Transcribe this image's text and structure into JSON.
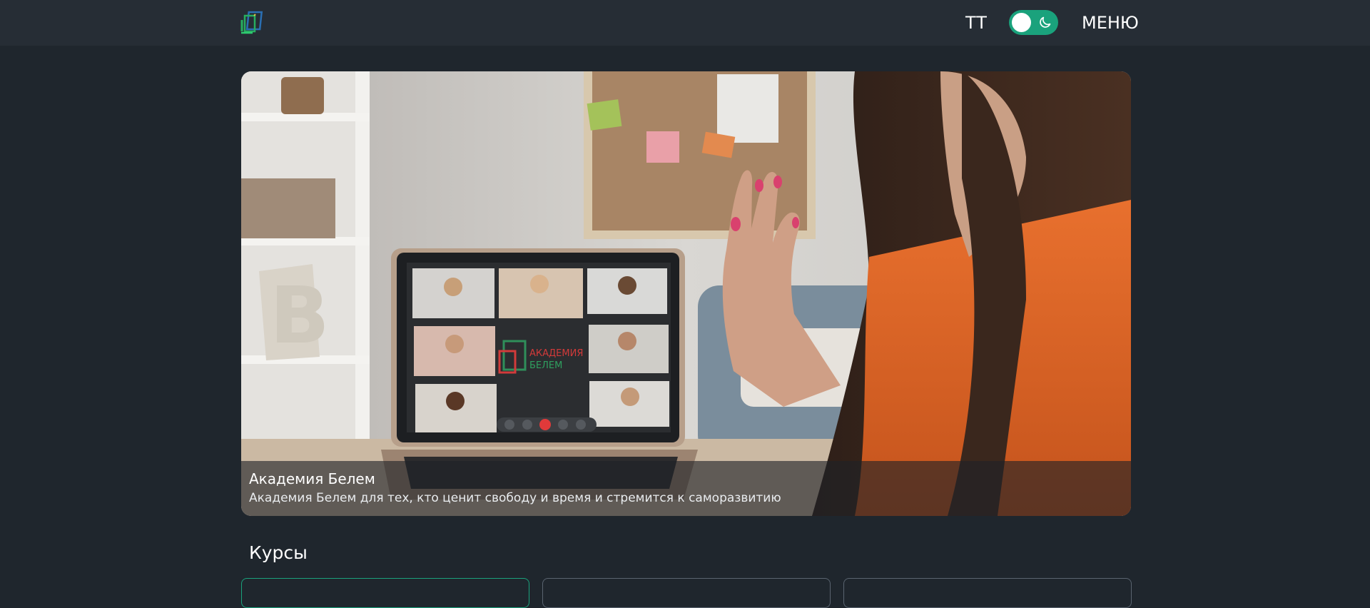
{
  "header": {
    "logo_icon": "academy-logo-icon",
    "font_size_label": "TT",
    "theme_toggle": {
      "state": "dark",
      "icon": "moon-icon",
      "accent": "#1aa27c"
    },
    "menu_label": "МЕНЮ"
  },
  "hero": {
    "title": "Академия Белем",
    "subtitle": "Академия Белем для тех, кто ценит свободу и время и стремится к саморазвитию",
    "laptop_brand": {
      "line1": "АКАДЕМИЯ",
      "line2": "БЕЛЕМ"
    }
  },
  "courses": {
    "heading": "Курсы",
    "cards_visible": 3
  },
  "colors": {
    "background": "#1f262d",
    "header": "#262d35",
    "accent": "#1aa27c"
  }
}
